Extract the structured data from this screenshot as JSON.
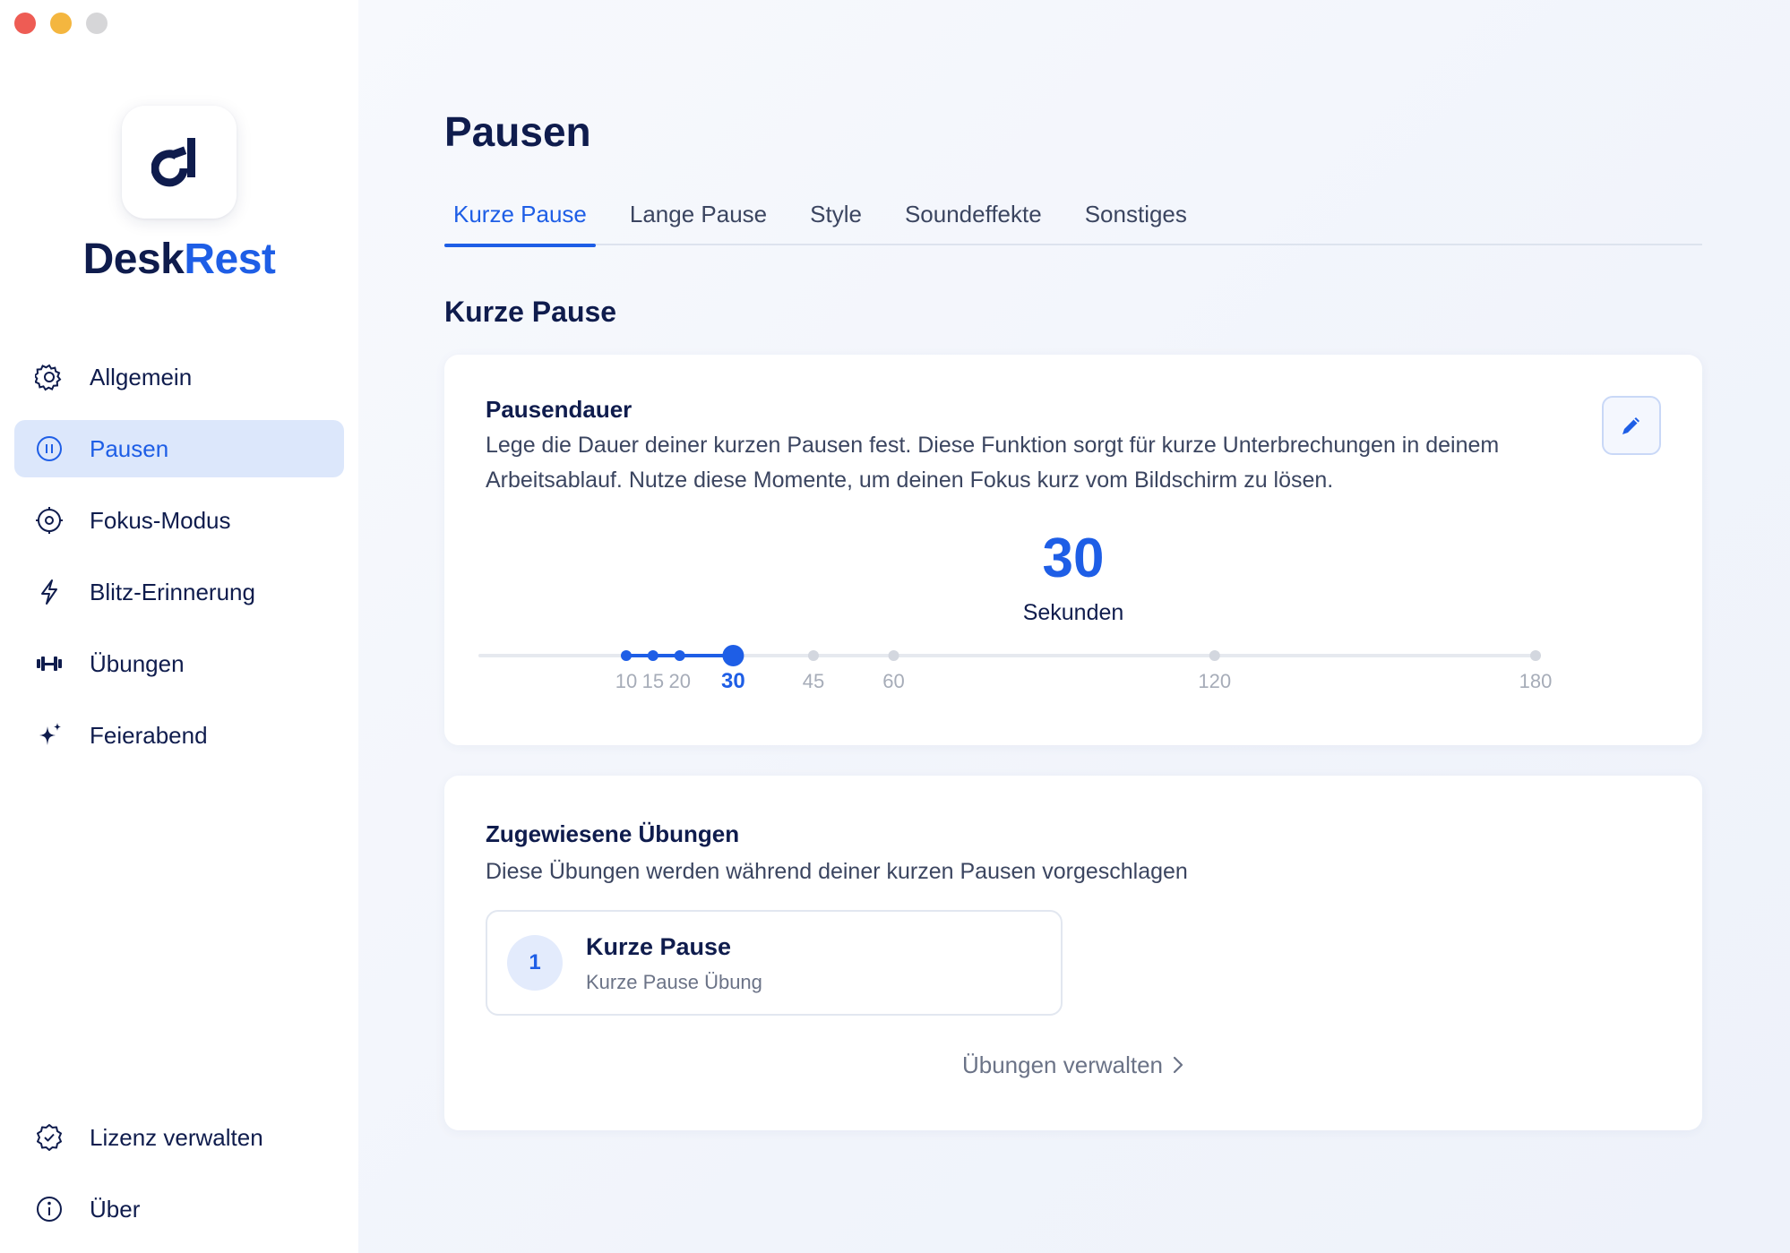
{
  "window": {
    "controls": {
      "close_color": "#ee5c54",
      "minimize_color": "#f4b63f",
      "zoom_color": "#d6d6d8"
    }
  },
  "brand": {
    "part1": "Desk",
    "part2": "Rest",
    "accent_color": "#1e5ee6"
  },
  "sidebar": {
    "items": [
      {
        "label": "Allgemein",
        "icon": "gear-icon"
      },
      {
        "label": "Pausen",
        "icon": "pause-circle-icon",
        "active": true
      },
      {
        "label": "Fokus-Modus",
        "icon": "target-icon"
      },
      {
        "label": "Blitz-Erinnerung",
        "icon": "lightning-icon"
      },
      {
        "label": "Übungen",
        "icon": "dumbbell-icon"
      },
      {
        "label": "Feierabend",
        "icon": "sparkles-icon"
      }
    ],
    "bottom_items": [
      {
        "label": "Lizenz verwalten",
        "icon": "badge-check-icon"
      },
      {
        "label": "Über",
        "icon": "info-icon"
      }
    ]
  },
  "main": {
    "title": "Pausen",
    "tabs": [
      {
        "label": "Kurze Pause",
        "active": true
      },
      {
        "label": "Lange Pause"
      },
      {
        "label": "Style"
      },
      {
        "label": "Soundeffekte"
      },
      {
        "label": "Sonstiges"
      }
    ],
    "section_title": "Kurze Pause",
    "duration_card": {
      "heading": "Pausendauer",
      "description": "Lege die Dauer deiner kurzen Pausen fest. Diese Funktion sorgt für kurze Unterbrechungen in deinem Arbeitsablauf. Nutze diese Momente, um deinen Fokus kurz vom Bildschirm zu lösen.",
      "value": "30",
      "unit": "Sekunden",
      "slider": {
        "options": [
          "10",
          "15",
          "20",
          "30",
          "45",
          "60",
          "120",
          "180"
        ],
        "selected": "30"
      }
    },
    "exercises_card": {
      "heading": "Zugewiesene Übungen",
      "description": "Diese Übungen werden während deiner kurzen Pausen vorgeschlagen",
      "items": [
        {
          "number": "1",
          "title": "Kurze Pause",
          "subtitle": "Kurze Pause Übung"
        }
      ],
      "manage_link": "Übungen verwalten"
    }
  }
}
